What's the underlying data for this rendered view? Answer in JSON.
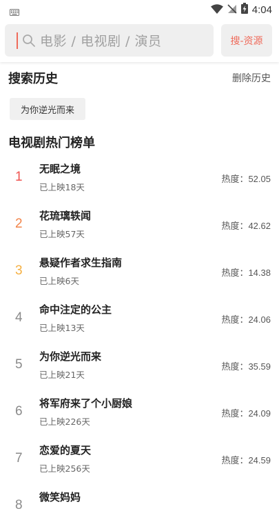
{
  "status_bar": {
    "time": "4:04"
  },
  "search": {
    "placeholder": "电影 / 电视剧 / 演员",
    "source_button": "搜-资源"
  },
  "history": {
    "title": "搜索历史",
    "clear_label": "删除历史",
    "items": [
      "为你逆光而来"
    ]
  },
  "hot_list": {
    "title": "电视剧热门榜单",
    "heat_label": "热度：",
    "rank_colors": [
      "#ef5350",
      "#f2844a",
      "#f5b042"
    ],
    "default_rank_color": "#8a8a8a",
    "items": [
      {
        "rank": "1",
        "name": "无眠之境",
        "sub": "已上映18天",
        "heat": "52.05"
      },
      {
        "rank": "2",
        "name": "花琉璃轶闻",
        "sub": "已上映57天",
        "heat": "42.62"
      },
      {
        "rank": "3",
        "name": "悬疑作者求生指南",
        "sub": "已上映6天",
        "heat": "14.38"
      },
      {
        "rank": "4",
        "name": "命中注定的公主",
        "sub": "已上映13天",
        "heat": "24.06"
      },
      {
        "rank": "5",
        "name": "为你逆光而来",
        "sub": "已上映21天",
        "heat": "35.59"
      },
      {
        "rank": "6",
        "name": "将军府来了个小厨娘",
        "sub": "已上映226天",
        "heat": "24.09"
      },
      {
        "rank": "7",
        "name": "恋爱的夏天",
        "sub": "已上映256天",
        "heat": "24.59"
      },
      {
        "rank": "8",
        "name": "微笑妈妈",
        "sub": "",
        "heat": ""
      }
    ]
  }
}
